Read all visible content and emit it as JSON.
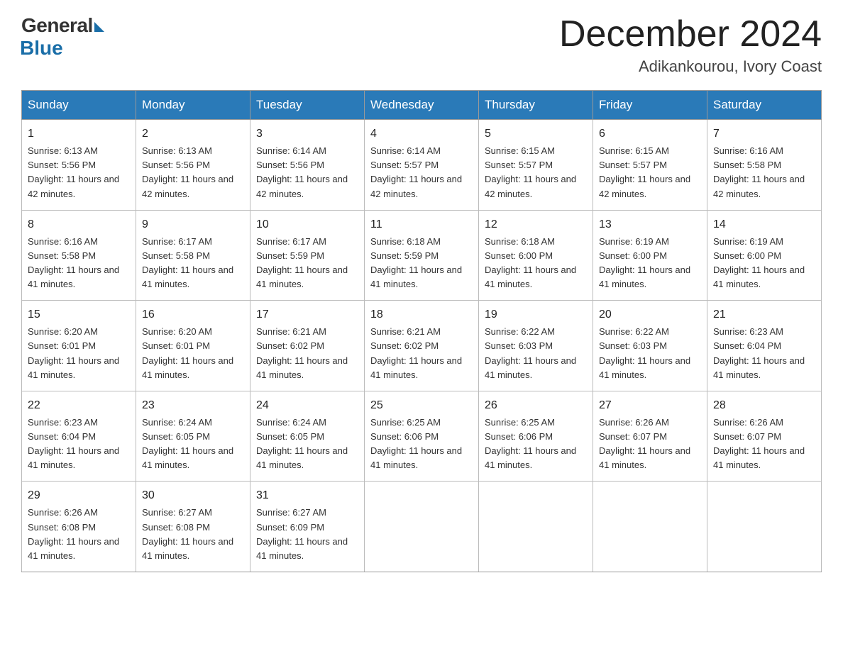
{
  "header": {
    "logo_general": "General",
    "logo_blue": "Blue",
    "month_title": "December 2024",
    "location": "Adikankourou, Ivory Coast"
  },
  "days_of_week": [
    "Sunday",
    "Monday",
    "Tuesday",
    "Wednesday",
    "Thursday",
    "Friday",
    "Saturday"
  ],
  "weeks": [
    [
      {
        "day": "1",
        "sunrise": "6:13 AM",
        "sunset": "5:56 PM",
        "daylight": "11 hours and 42 minutes."
      },
      {
        "day": "2",
        "sunrise": "6:13 AM",
        "sunset": "5:56 PM",
        "daylight": "11 hours and 42 minutes."
      },
      {
        "day": "3",
        "sunrise": "6:14 AM",
        "sunset": "5:56 PM",
        "daylight": "11 hours and 42 minutes."
      },
      {
        "day": "4",
        "sunrise": "6:14 AM",
        "sunset": "5:57 PM",
        "daylight": "11 hours and 42 minutes."
      },
      {
        "day": "5",
        "sunrise": "6:15 AM",
        "sunset": "5:57 PM",
        "daylight": "11 hours and 42 minutes."
      },
      {
        "day": "6",
        "sunrise": "6:15 AM",
        "sunset": "5:57 PM",
        "daylight": "11 hours and 42 minutes."
      },
      {
        "day": "7",
        "sunrise": "6:16 AM",
        "sunset": "5:58 PM",
        "daylight": "11 hours and 42 minutes."
      }
    ],
    [
      {
        "day": "8",
        "sunrise": "6:16 AM",
        "sunset": "5:58 PM",
        "daylight": "11 hours and 41 minutes."
      },
      {
        "day": "9",
        "sunrise": "6:17 AM",
        "sunset": "5:58 PM",
        "daylight": "11 hours and 41 minutes."
      },
      {
        "day": "10",
        "sunrise": "6:17 AM",
        "sunset": "5:59 PM",
        "daylight": "11 hours and 41 minutes."
      },
      {
        "day": "11",
        "sunrise": "6:18 AM",
        "sunset": "5:59 PM",
        "daylight": "11 hours and 41 minutes."
      },
      {
        "day": "12",
        "sunrise": "6:18 AM",
        "sunset": "6:00 PM",
        "daylight": "11 hours and 41 minutes."
      },
      {
        "day": "13",
        "sunrise": "6:19 AM",
        "sunset": "6:00 PM",
        "daylight": "11 hours and 41 minutes."
      },
      {
        "day": "14",
        "sunrise": "6:19 AM",
        "sunset": "6:00 PM",
        "daylight": "11 hours and 41 minutes."
      }
    ],
    [
      {
        "day": "15",
        "sunrise": "6:20 AM",
        "sunset": "6:01 PM",
        "daylight": "11 hours and 41 minutes."
      },
      {
        "day": "16",
        "sunrise": "6:20 AM",
        "sunset": "6:01 PM",
        "daylight": "11 hours and 41 minutes."
      },
      {
        "day": "17",
        "sunrise": "6:21 AM",
        "sunset": "6:02 PM",
        "daylight": "11 hours and 41 minutes."
      },
      {
        "day": "18",
        "sunrise": "6:21 AM",
        "sunset": "6:02 PM",
        "daylight": "11 hours and 41 minutes."
      },
      {
        "day": "19",
        "sunrise": "6:22 AM",
        "sunset": "6:03 PM",
        "daylight": "11 hours and 41 minutes."
      },
      {
        "day": "20",
        "sunrise": "6:22 AM",
        "sunset": "6:03 PM",
        "daylight": "11 hours and 41 minutes."
      },
      {
        "day": "21",
        "sunrise": "6:23 AM",
        "sunset": "6:04 PM",
        "daylight": "11 hours and 41 minutes."
      }
    ],
    [
      {
        "day": "22",
        "sunrise": "6:23 AM",
        "sunset": "6:04 PM",
        "daylight": "11 hours and 41 minutes."
      },
      {
        "day": "23",
        "sunrise": "6:24 AM",
        "sunset": "6:05 PM",
        "daylight": "11 hours and 41 minutes."
      },
      {
        "day": "24",
        "sunrise": "6:24 AM",
        "sunset": "6:05 PM",
        "daylight": "11 hours and 41 minutes."
      },
      {
        "day": "25",
        "sunrise": "6:25 AM",
        "sunset": "6:06 PM",
        "daylight": "11 hours and 41 minutes."
      },
      {
        "day": "26",
        "sunrise": "6:25 AM",
        "sunset": "6:06 PM",
        "daylight": "11 hours and 41 minutes."
      },
      {
        "day": "27",
        "sunrise": "6:26 AM",
        "sunset": "6:07 PM",
        "daylight": "11 hours and 41 minutes."
      },
      {
        "day": "28",
        "sunrise": "6:26 AM",
        "sunset": "6:07 PM",
        "daylight": "11 hours and 41 minutes."
      }
    ],
    [
      {
        "day": "29",
        "sunrise": "6:26 AM",
        "sunset": "6:08 PM",
        "daylight": "11 hours and 41 minutes."
      },
      {
        "day": "30",
        "sunrise": "6:27 AM",
        "sunset": "6:08 PM",
        "daylight": "11 hours and 41 minutes."
      },
      {
        "day": "31",
        "sunrise": "6:27 AM",
        "sunset": "6:09 PM",
        "daylight": "11 hours and 41 minutes."
      },
      null,
      null,
      null,
      null
    ]
  ]
}
